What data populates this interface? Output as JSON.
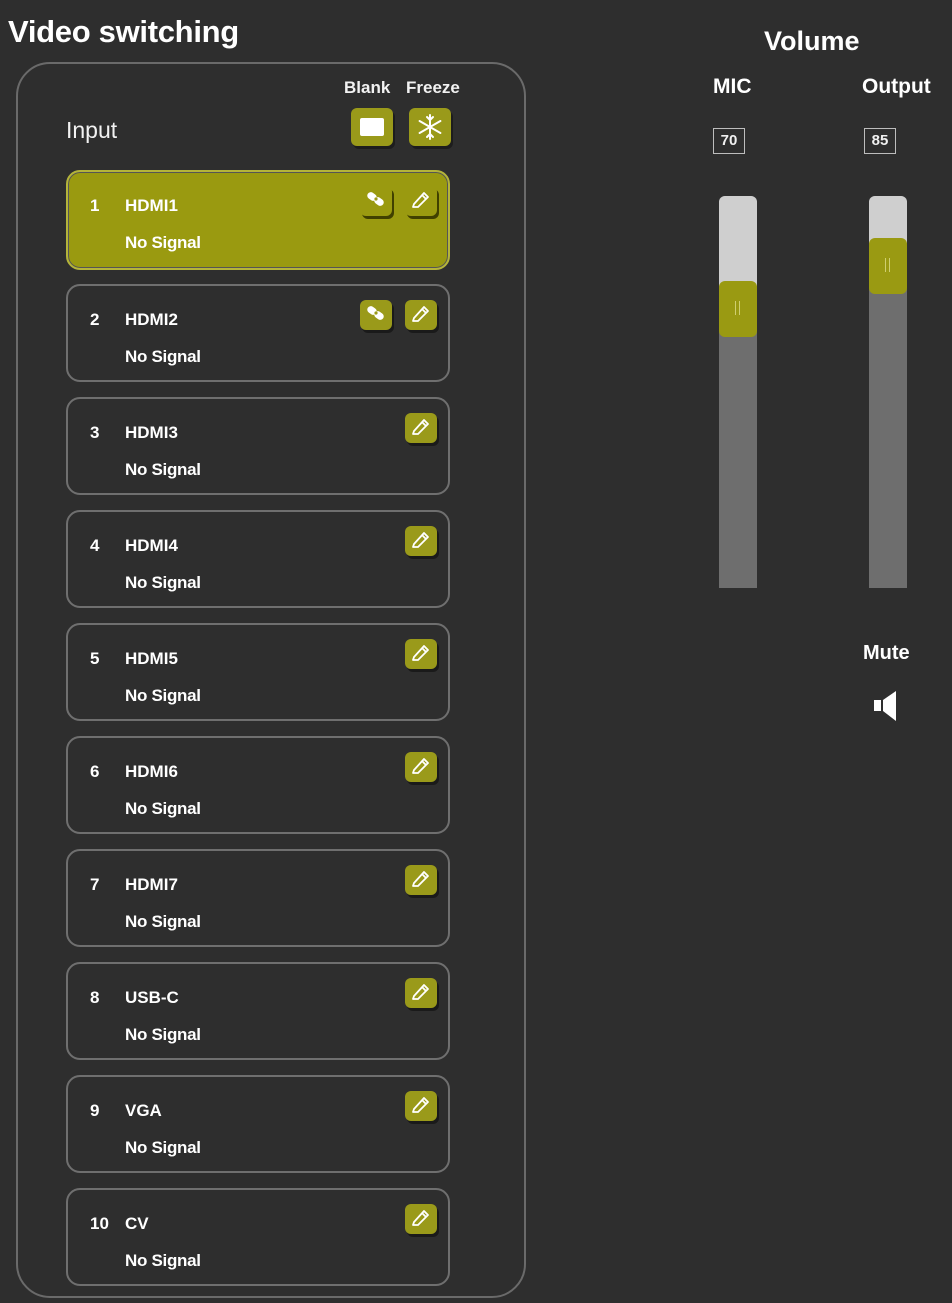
{
  "video_switching": {
    "title": "Video switching",
    "input_label": "Input",
    "blank_label": "Blank",
    "freeze_label": "Freeze",
    "inputs": [
      {
        "num": "1",
        "name": "HDMI1",
        "status": "No Signal",
        "selected": true,
        "has_link_icon": true
      },
      {
        "num": "2",
        "name": "HDMI2",
        "status": "No Signal",
        "selected": false,
        "has_link_icon": true
      },
      {
        "num": "3",
        "name": "HDMI3",
        "status": "No Signal",
        "selected": false,
        "has_link_icon": false
      },
      {
        "num": "4",
        "name": "HDMI4",
        "status": "No Signal",
        "selected": false,
        "has_link_icon": false
      },
      {
        "num": "5",
        "name": "HDMI5",
        "status": "No Signal",
        "selected": false,
        "has_link_icon": false
      },
      {
        "num": "6",
        "name": "HDMI6",
        "status": "No Signal",
        "selected": false,
        "has_link_icon": false
      },
      {
        "num": "7",
        "name": "HDMI7",
        "status": "No Signal",
        "selected": false,
        "has_link_icon": false
      },
      {
        "num": "8",
        "name": "USB-C",
        "status": "No Signal",
        "selected": false,
        "has_link_icon": false
      },
      {
        "num": "9",
        "name": "VGA",
        "status": "No Signal",
        "selected": false,
        "has_link_icon": false
      },
      {
        "num": "10",
        "name": "CV",
        "status": "No Signal",
        "selected": false,
        "has_link_icon": false
      }
    ]
  },
  "volume": {
    "title": "Volume",
    "mic": {
      "label": "MIC",
      "value": "70",
      "level_percent": 70
    },
    "output": {
      "label": "Output",
      "value": "85",
      "level_percent": 85
    },
    "mute_label": "Mute"
  },
  "icons": {
    "blank": "blank-screen-icon",
    "freeze": "snowflake-icon",
    "link": "link-icon",
    "edit": "pencil-icon",
    "mute": "speaker-icon"
  },
  "colors": {
    "accent": "#9a9a1a",
    "background": "#2e2e2e",
    "border": "#6f6f6f",
    "slider_track": "#6e6e6e",
    "slider_empty": "#cfcfcf"
  }
}
